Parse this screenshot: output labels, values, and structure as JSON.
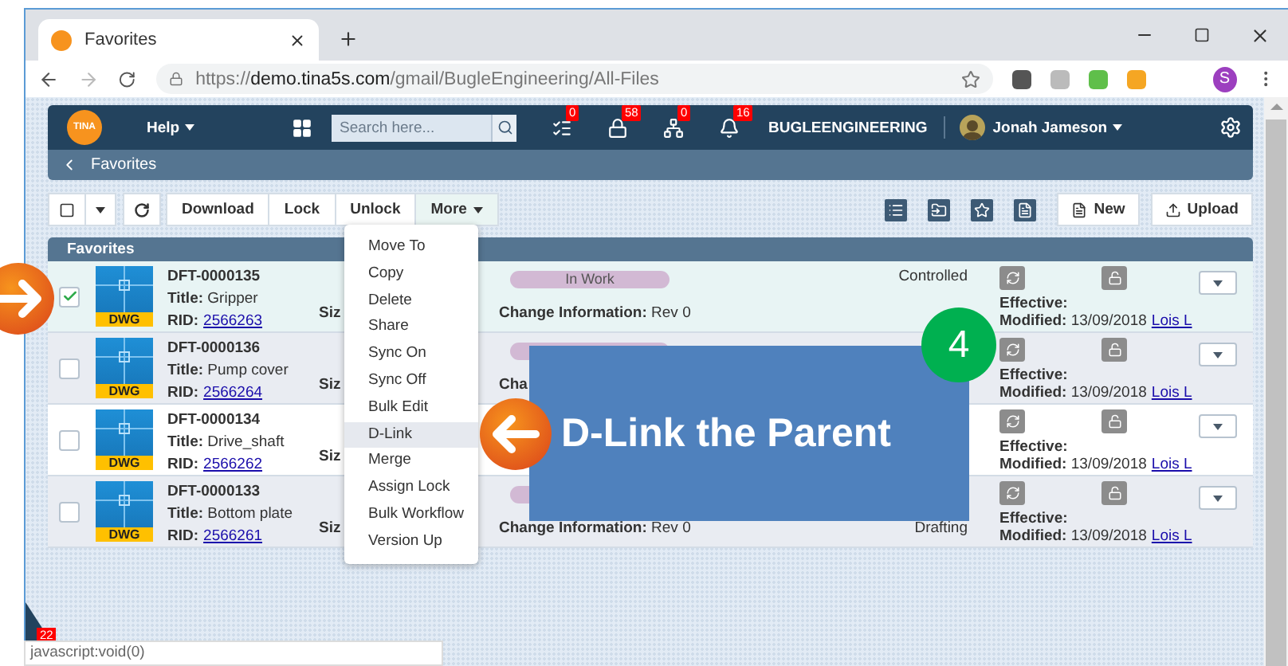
{
  "browser": {
    "tab_title": "Favorites",
    "url": {
      "scheme": "https://",
      "host": "demo.tina5s.com",
      "path": "/gmail/BugleEngineering/All-Files"
    },
    "profile_initial": "S"
  },
  "topbar": {
    "logo": "TINA",
    "help": "Help",
    "search_placeholder": "Search here...",
    "badges": [
      {
        "kind": "tasks",
        "count": "0"
      },
      {
        "kind": "lock",
        "count": "58"
      },
      {
        "kind": "hierarchy",
        "count": "0"
      },
      {
        "kind": "bell",
        "count": "16"
      }
    ],
    "company": "BUGLEENGINEERING",
    "user": "Jonah Jameson"
  },
  "breadcrumb": "Favorites",
  "toolbar": {
    "buttons": [
      {
        "label": "Download",
        "expanded": false
      },
      {
        "label": "Lock",
        "expanded": false
      },
      {
        "label": "Unlock",
        "expanded": false
      },
      {
        "label": "More",
        "expanded": true
      }
    ],
    "actions": [
      "New",
      "Upload"
    ]
  },
  "table": {
    "title": "Favorites",
    "rows": [
      {
        "id": "DFT-0000135",
        "title_label": "Title:",
        "title": "Gripper",
        "rid_label": "RID:",
        "rid": "2566263",
        "size_label": "Siz",
        "file_type": "DWG",
        "checked": true,
        "hovered": false,
        "status": "In Work",
        "change_label": "Change Information:",
        "change_value": "Rev 0",
        "state_top": "Controlled",
        "effective_label": "Effective:",
        "modified_label": "Modified:",
        "modified": "13/09/2018",
        "user": "Lois L"
      },
      {
        "id": "DFT-0000136",
        "title_label": "Title:",
        "title": "Pump cover",
        "rid_label": "RID:",
        "rid": "2566264",
        "size_label": "Siz",
        "file_type": "DWG",
        "checked": false,
        "hovered": false,
        "change_label": "Cha",
        "effective_label": "Effective:",
        "modified_label": "Modified:",
        "modified": "13/09/2018",
        "user": "Lois L"
      },
      {
        "id": "DFT-0000134",
        "title_label": "Title:",
        "title": "Drive_shaft",
        "rid_label": "RID:",
        "rid": "2566262",
        "size_label": "Siz",
        "file_type": "DWG",
        "checked": false,
        "hovered": true,
        "effective_label": "Effective:",
        "modified_label": "Modified:",
        "modified": "13/09/2018",
        "user": "Lois L"
      },
      {
        "id": "DFT-0000133",
        "title_label": "Title:",
        "title": "Bottom plate",
        "rid_label": "RID:",
        "rid": "2566261",
        "size_label": "Siz",
        "file_type": "DWG",
        "checked": false,
        "hovered": false,
        "change_label": "Change Information:",
        "change_value": "Rev 0",
        "state_bottom": "Drafting",
        "effective_label": "Effective:",
        "modified_label": "Modified:",
        "modified": "13/09/2018",
        "user": "Lois L"
      }
    ]
  },
  "menu": {
    "items": [
      {
        "label": "Move To",
        "selected": false
      },
      {
        "label": "Copy",
        "selected": false
      },
      {
        "label": "Delete",
        "selected": false
      },
      {
        "label": "Share",
        "selected": false
      },
      {
        "label": "Sync On",
        "selected": false
      },
      {
        "label": "Sync Off",
        "selected": false
      },
      {
        "label": "Bulk Edit",
        "selected": false
      },
      {
        "label": "D-Link",
        "selected": true
      },
      {
        "label": "Merge",
        "selected": false
      },
      {
        "label": "Assign Lock",
        "selected": false
      },
      {
        "label": "Bulk Workflow",
        "selected": false
      },
      {
        "label": "Version Up",
        "selected": false
      }
    ]
  },
  "callout": {
    "text": "D-Link the Parent",
    "step": "4"
  },
  "corner_badge": "22",
  "status_bar": "javascript:void(0)"
}
